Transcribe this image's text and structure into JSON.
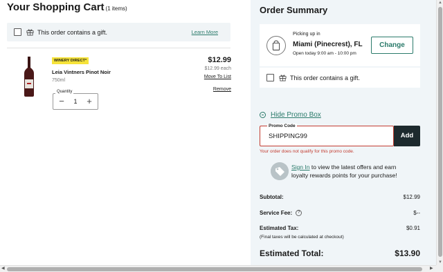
{
  "cart": {
    "title": "Your Shopping Cart",
    "count": "(1 items)",
    "gift_text": "This order contains a gift.",
    "learn_more": "Learn More",
    "item": {
      "badge": "WINERY DIRECT*",
      "name": "Leia Vintners Pinot Noir",
      "size": "750ml",
      "quantity_label": "Quantity",
      "quantity": "1",
      "price": "$12.99",
      "each": "$12.99 each",
      "move_to_list": "Move To List",
      "remove": "Remove"
    }
  },
  "summary": {
    "title": "Order Summary",
    "pickup_label": "Picking up in",
    "pickup_city": "Miami (Pinecrest), FL",
    "pickup_hours": "Open today 9:00 am - 10:00 pm",
    "change": "Change",
    "gift_text": "This order contains a gift.",
    "promo_toggle": "Hide Promo Box",
    "promo_label": "Promo Code",
    "promo_value": "SHIPPING99",
    "add": "Add",
    "promo_error": "Your order does not qualify for this promo code.",
    "signin": "Sign In",
    "loyalty_line1_rest": " to view the latest offers and earn",
    "loyalty_line2": "loyalty rewards points for your purchase!",
    "subtotal_label": "Subtotal:",
    "subtotal_value": "$12.99",
    "service_fee_label": "Service Fee:",
    "service_fee_value": "$--",
    "tax_label": "Estimated Tax:",
    "tax_value": "$0.91",
    "tax_note": "(Final taxes will be calculated at checkout)",
    "total_label": "Estimated Total:",
    "total_value": "$13.90"
  },
  "colors": {
    "accent": "#2a7a6a",
    "error": "#c23b2f",
    "summary_bg": "#f0f5f8",
    "badge": "#f6e33a",
    "add_button": "#1d2a2e"
  },
  "icons": [
    "gift-icon",
    "wine-bottle-icon",
    "minus-icon",
    "plus-icon",
    "shopping-bag-icon",
    "collapse-circle-icon",
    "tag-icon",
    "info-icon"
  ]
}
